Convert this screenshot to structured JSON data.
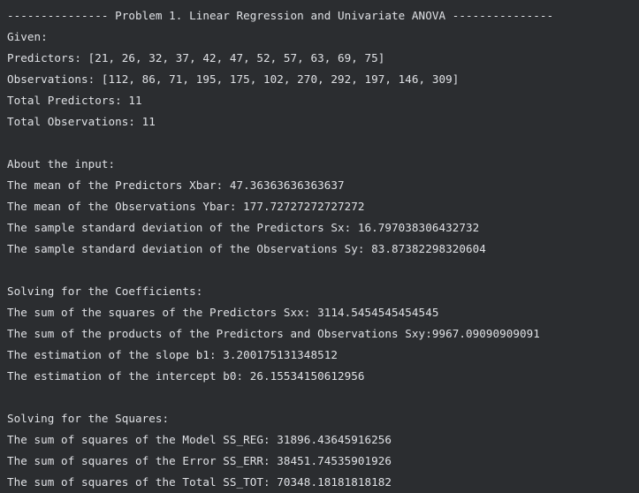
{
  "console": {
    "lines": [
      "--------------- Problem 1. Linear Regression and Univariate ANOVA ---------------",
      "Given:",
      "Predictors: [21, 26, 32, 37, 42, 47, 52, 57, 63, 69, 75]",
      "Observations: [112, 86, 71, 195, 175, 102, 270, 292, 197, 146, 309]",
      "Total Predictors: 11",
      "Total Observations: 11",
      "",
      "About the input:",
      "The mean of the Predictors Xbar: 47.36363636363637",
      "The mean of the Observations Ybar: 177.72727272727272",
      "The sample standard deviation of the Predictors Sx: 16.797038306432732",
      "The sample standard deviation of the Observations Sy: 83.87382298320604",
      "",
      "Solving for the Coefficients:",
      "The sum of the squares of the Predictors Sxx: 3114.5454545454545",
      "The sum of the products of the Predictors and Observations Sxy:9967.09090909091",
      "The estimation of the slope b1: 3.200175131348512",
      "The estimation of the intercept b0: 26.15534150612956",
      "",
      "Solving for the Squares:",
      "The sum of squares of the Model SS_REG: 31896.43645916256",
      "The sum of squares of the Error SS_ERR: 38451.74535901926",
      "The sum of squares of the Total SS_TOT: 70348.18181818182"
    ]
  }
}
